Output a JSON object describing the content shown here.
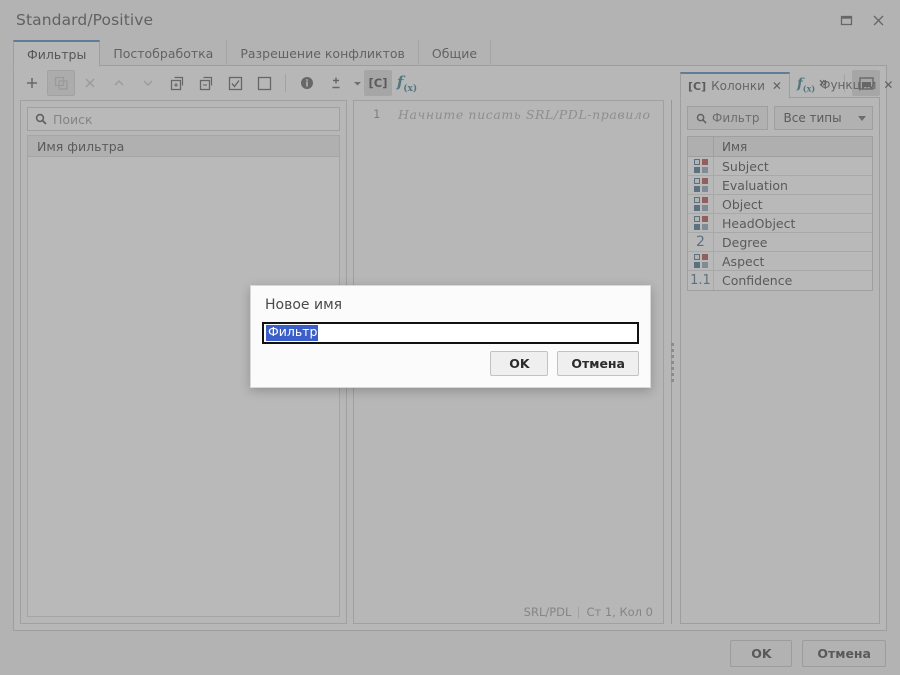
{
  "window": {
    "title": "Standard/Positive",
    "controls": [
      {
        "name": "maximize",
        "glyph": "maximize-icon"
      },
      {
        "name": "close",
        "glyph": "close-icon"
      }
    ]
  },
  "tabs": [
    {
      "label": "Фильтры",
      "active": true
    },
    {
      "label": "Постобработка",
      "active": false
    },
    {
      "label": "Разрешение конфликтов",
      "active": false
    },
    {
      "label": "Общие",
      "active": false
    }
  ],
  "toolbar": {
    "buttons": [
      {
        "name": "add",
        "glyph": "plus-icon",
        "state": "enabled"
      },
      {
        "name": "duplicate",
        "glyph": "copy-icon",
        "state": "disabled"
      },
      {
        "name": "delete",
        "glyph": "close-x-icon",
        "state": "disabled"
      },
      {
        "name": "move-up",
        "glyph": "chevron-up-icon",
        "state": "disabled"
      },
      {
        "name": "move-down",
        "glyph": "chevron-down-icon",
        "state": "disabled"
      },
      {
        "name": "import",
        "glyph": "import-icon",
        "state": "enabled"
      },
      {
        "name": "export",
        "glyph": "export-icon",
        "state": "enabled"
      },
      {
        "name": "check-all",
        "glyph": "checkbox-checked-icon",
        "state": "enabled"
      },
      {
        "name": "uncheck-all",
        "glyph": "checkbox-empty-icon",
        "state": "enabled"
      },
      {
        "name": "info",
        "glyph": "info-icon",
        "state": "enabled"
      },
      {
        "name": "plus-minus",
        "glyph": "plus-minus-icon",
        "state": "enabled"
      },
      {
        "name": "columns-panel",
        "glyph": "bracket-c-icon",
        "state": "active",
        "text": "[C]"
      },
      {
        "name": "functions-panel",
        "glyph": "fx-icon",
        "text": "f(x)"
      },
      {
        "name": "overflow",
        "glyph": "chevron-double-right-icon",
        "text": "»"
      },
      {
        "name": "toggle-dock",
        "glyph": "panel-icon",
        "state": "active"
      }
    ]
  },
  "left_pane": {
    "search": {
      "placeholder": "Поиск",
      "value": "",
      "icon": "search-icon"
    },
    "column_header": "Имя фильтра",
    "rows": []
  },
  "editor": {
    "line_numbers": [
      "1"
    ],
    "placeholder": "Начните писать SRL/PDL-правило",
    "status": {
      "language": "SRL/PDL",
      "position": "Ст 1, Кол 0"
    }
  },
  "dock": {
    "tabs": [
      {
        "label": "Колонки",
        "prefix": "[C]",
        "icon": "bracket-c-icon",
        "active": true,
        "closable": true
      },
      {
        "label": "Функции",
        "prefix": "f(x)",
        "icon": "fx-icon",
        "active": false,
        "closable": true
      }
    ],
    "filter_button": {
      "label": "Фильтр",
      "icon": "search-icon"
    },
    "type_select": {
      "value": "Все типы"
    },
    "table": {
      "headers": [
        "",
        "Имя"
      ],
      "rows": [
        {
          "icon": "type-string-icon",
          "name": "Subject"
        },
        {
          "icon": "type-string-icon",
          "name": "Evaluation"
        },
        {
          "icon": "type-string-icon",
          "name": "Object"
        },
        {
          "icon": "type-string-icon",
          "name": "HeadObject"
        },
        {
          "icon": "type-integer-icon",
          "icon_text": "2",
          "name": "Degree"
        },
        {
          "icon": "type-string-icon",
          "name": "Aspect"
        },
        {
          "icon": "type-float-icon",
          "icon_text": "1.1",
          "name": "Confidence"
        }
      ]
    }
  },
  "footer": {
    "ok_label": "OK",
    "cancel_label": "Отмена"
  },
  "dialog": {
    "title": "Новое имя",
    "input": {
      "value": "Фильтр",
      "selected": true
    },
    "ok_label": "OK",
    "cancel_label": "Отмена"
  },
  "colors": {
    "accent": "#3c79b4",
    "selection": "#3b5ec9",
    "type_blue": "#2f5f82",
    "type_red": "#a63a33",
    "type_gray": "#7f9cb0",
    "fx_teal": "#1b6a7d"
  }
}
